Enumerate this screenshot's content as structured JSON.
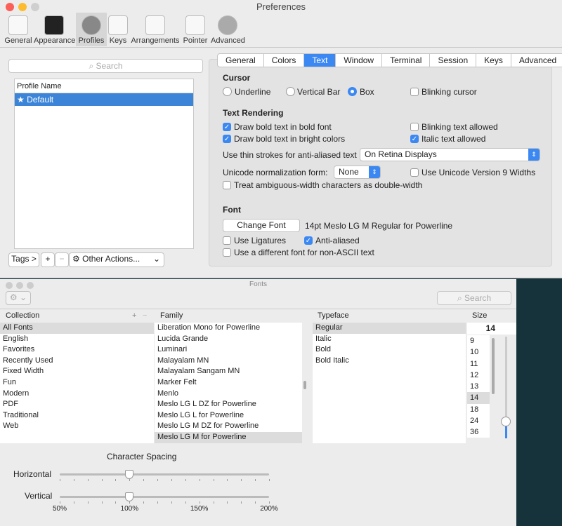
{
  "prefs": {
    "title": "Preferences",
    "toolbar": [
      {
        "label": "General"
      },
      {
        "label": "Appearance"
      },
      {
        "label": "Profiles",
        "selected": true
      },
      {
        "label": "Keys"
      },
      {
        "label": "Arrangements"
      },
      {
        "label": "Pointer"
      },
      {
        "label": "Advanced"
      }
    ],
    "search_placeholder": "Search",
    "profile_header": "Profile Name",
    "profiles": [
      "★ Default"
    ],
    "tags_button": "Tags >",
    "add": "+",
    "remove": "−",
    "other_actions": "Other Actions...",
    "tabs": [
      "General",
      "Colors",
      "Text",
      "Window",
      "Terminal",
      "Session",
      "Keys",
      "Advanced"
    ],
    "selected_tab": "Text",
    "cursor": {
      "heading": "Cursor",
      "underline": "Underline",
      "vertical_bar": "Vertical Bar",
      "box": "Box",
      "selected": "Box",
      "blinking": "Blinking cursor",
      "blinking_checked": false
    },
    "rendering": {
      "heading": "Text Rendering",
      "bold_font": "Draw bold text in bold font",
      "bold_font_checked": true,
      "blinking_allowed": "Blinking text allowed",
      "blinking_allowed_checked": false,
      "bright_colors": "Draw bold text in bright colors",
      "bright_colors_checked": true,
      "italic_allowed": "Italic text allowed",
      "italic_allowed_checked": true,
      "thin_strokes_label": "Use thin strokes for anti-aliased text",
      "thin_strokes_value": "On Retina Displays",
      "unicode_label": "Unicode normalization form:",
      "unicode_value": "None",
      "unicode9": "Use Unicode Version 9 Widths",
      "unicode9_checked": false,
      "ambiguous": "Treat ambiguous-width characters as double-width",
      "ambiguous_checked": false
    },
    "font": {
      "heading": "Font",
      "change_font": "Change Font",
      "current": "14pt Meslo LG M Regular for Powerline",
      "ligatures": "Use Ligatures",
      "ligatures_checked": false,
      "anti_aliased": "Anti-aliased",
      "anti_aliased_checked": true,
      "non_ascii": "Use a different font for non-ASCII text",
      "non_ascii_checked": false
    }
  },
  "fonts": {
    "title": "Fonts",
    "search_placeholder": "Search",
    "headers": {
      "collection": "Collection",
      "family": "Family",
      "typeface": "Typeface",
      "size": "Size"
    },
    "collections": [
      "All Fonts",
      "English",
      "Favorites",
      "Recently Used",
      "Fixed Width",
      "Fun",
      "Modern",
      "PDF",
      "Traditional",
      "Web"
    ],
    "selected_collection": "All Fonts",
    "families": [
      "Liberation Mono for Powerline",
      "Lucida Grande",
      "Luminari",
      "Malayalam MN",
      "Malayalam Sangam MN",
      "Marker Felt",
      "Menlo",
      "Meslo LG L DZ for Powerline",
      "Meslo LG L for Powerline",
      "Meslo LG M DZ for Powerline",
      "Meslo LG M for Powerline"
    ],
    "selected_family": "Meslo LG M for Powerline",
    "typefaces": [
      "Regular",
      "Italic",
      "Bold",
      "Bold Italic"
    ],
    "selected_typeface": "Regular",
    "size_value": "14",
    "sizes": [
      "9",
      "10",
      "11",
      "12",
      "13",
      "14",
      "18",
      "24",
      "36"
    ],
    "selected_size": "14",
    "spacing": {
      "heading": "Character Spacing",
      "horizontal": "Horizontal",
      "vertical": "Vertical",
      "ticks": [
        "50%",
        "100%",
        "150%",
        "200%"
      ],
      "horizontal_value": "100%",
      "vertical_value": "100%"
    }
  }
}
